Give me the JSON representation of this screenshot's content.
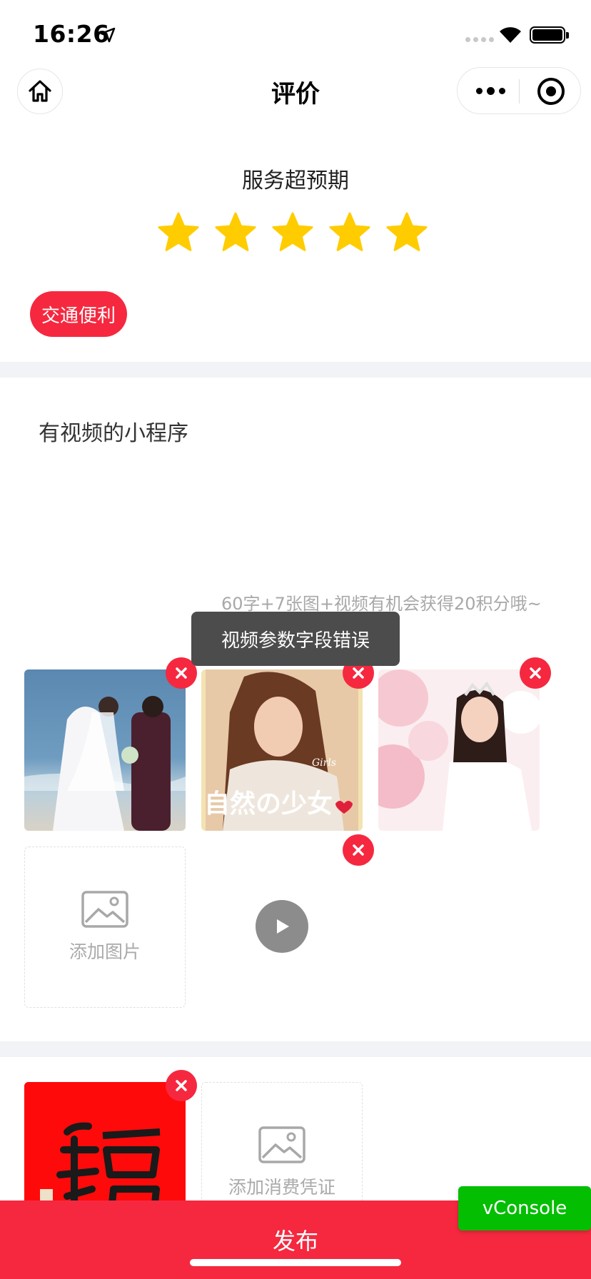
{
  "status_bar": {
    "time": "16:26"
  },
  "nav": {
    "title": "评价"
  },
  "rating": {
    "label": "服务超预期",
    "stars": 5,
    "max_stars": 5,
    "star_color": "#FFCC00"
  },
  "tags": [
    {
      "label": "交通便利",
      "selected": true
    }
  ],
  "comment": {
    "text": "有视频的小程序",
    "hint": "60字+7张图+视频有机会获得20积分哦~"
  },
  "toast": {
    "message": "视频参数字段错误"
  },
  "photos": {
    "images": [
      "wedding-photo-beach",
      "portrait-photo-girl",
      "bride-photo-flowers"
    ],
    "poster_text": "自然の少女",
    "poster_small": "Girls",
    "add_label": "添加图片"
  },
  "receipt": {
    "add_label": "添加消费凭证"
  },
  "publish_label": "发布",
  "vconsole_label": "vConsole",
  "colors": {
    "accent": "#F5283F",
    "vconsole": "#04BE02"
  }
}
